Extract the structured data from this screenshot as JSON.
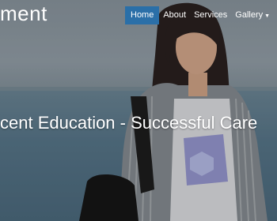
{
  "header": {
    "brand_text": "ment",
    "nav": [
      {
        "label": "Home"
      },
      {
        "label": "About"
      },
      {
        "label": "Services"
      },
      {
        "label": "Gallery"
      }
    ],
    "nav_overflow": "C"
  },
  "hero": {
    "tagline": "cent Education - Successful Care"
  },
  "colors": {
    "accent": "#2a6fa8",
    "text": "#ffffff"
  }
}
